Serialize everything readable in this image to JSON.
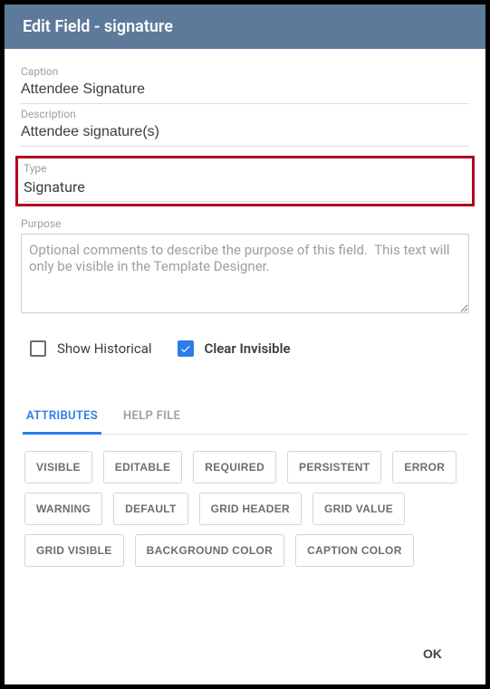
{
  "header": {
    "title": "Edit Field - signature"
  },
  "fields": {
    "caption": {
      "label": "Caption",
      "value": "Attendee Signature"
    },
    "description": {
      "label": "Description",
      "value": "Attendee signature(s)"
    },
    "type": {
      "label": "Type",
      "value": "Signature"
    },
    "purpose": {
      "label": "Purpose",
      "placeholder": "Optional comments to describe the purpose of this field.  This text will only be visible in the Template Designer."
    }
  },
  "checks": {
    "show_historical": {
      "label": "Show Historical",
      "checked": false
    },
    "clear_invisible": {
      "label": "Clear Invisible",
      "checked": true
    }
  },
  "tabs": {
    "attributes": "ATTRIBUTES",
    "helpfile": "HELP FILE"
  },
  "attributes": [
    "VISIBLE",
    "EDITABLE",
    "REQUIRED",
    "PERSISTENT",
    "ERROR",
    "WARNING",
    "DEFAULT",
    "GRID HEADER",
    "GRID VALUE",
    "GRID VISIBLE",
    "BACKGROUND COLOR",
    "CAPTION COLOR"
  ],
  "footer": {
    "ok": "OK"
  }
}
